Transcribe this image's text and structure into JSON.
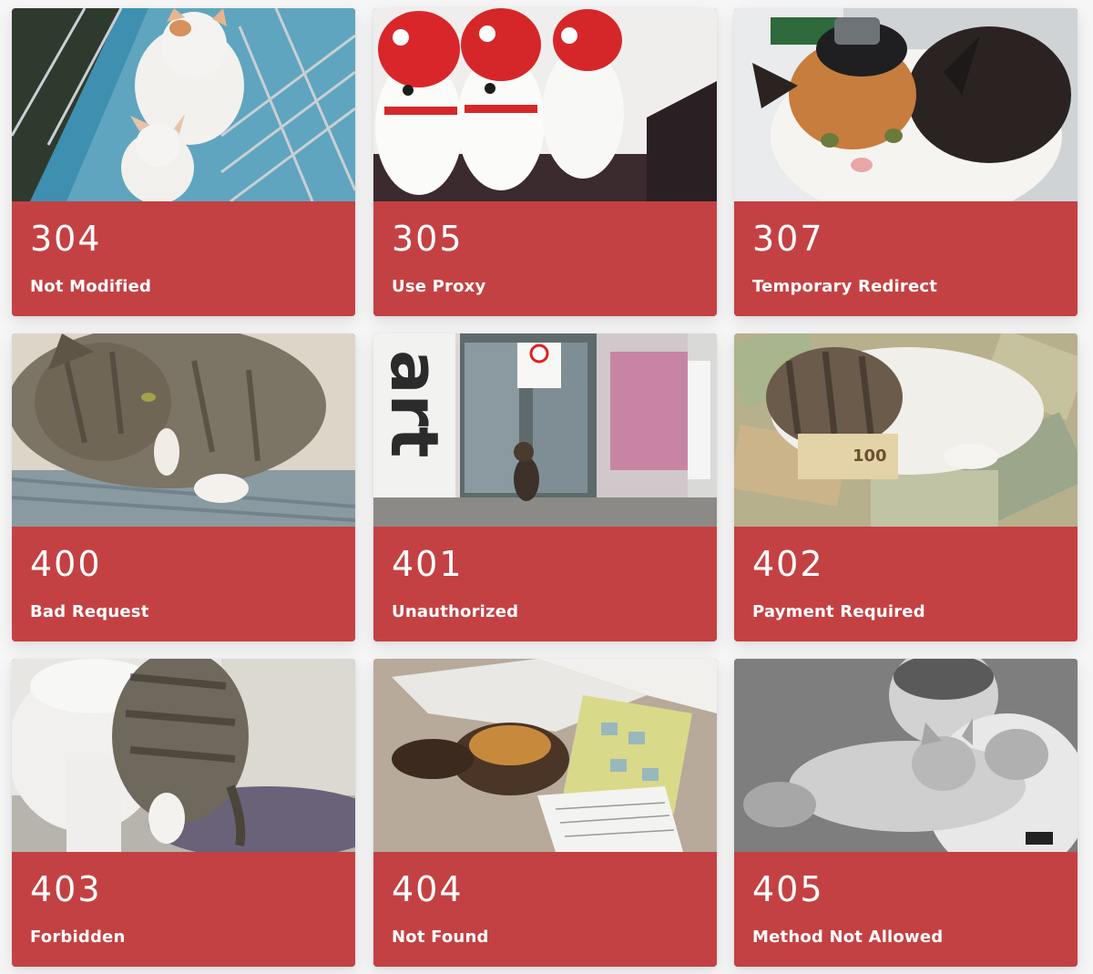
{
  "theme": {
    "card_color": "#c44143",
    "text_color": "#ffffff",
    "page_background": "#f6f6f7"
  },
  "cards": [
    {
      "code": "304",
      "label": "Not Modified"
    },
    {
      "code": "305",
      "label": "Use Proxy"
    },
    {
      "code": "307",
      "label": "Temporary Redirect"
    },
    {
      "code": "400",
      "label": "Bad Request"
    },
    {
      "code": "401",
      "label": "Unauthorized"
    },
    {
      "code": "402",
      "label": "Payment Required"
    },
    {
      "code": "403",
      "label": "Forbidden"
    },
    {
      "code": "404",
      "label": "Not Found"
    },
    {
      "code": "405",
      "label": "Method Not Allowed"
    }
  ]
}
